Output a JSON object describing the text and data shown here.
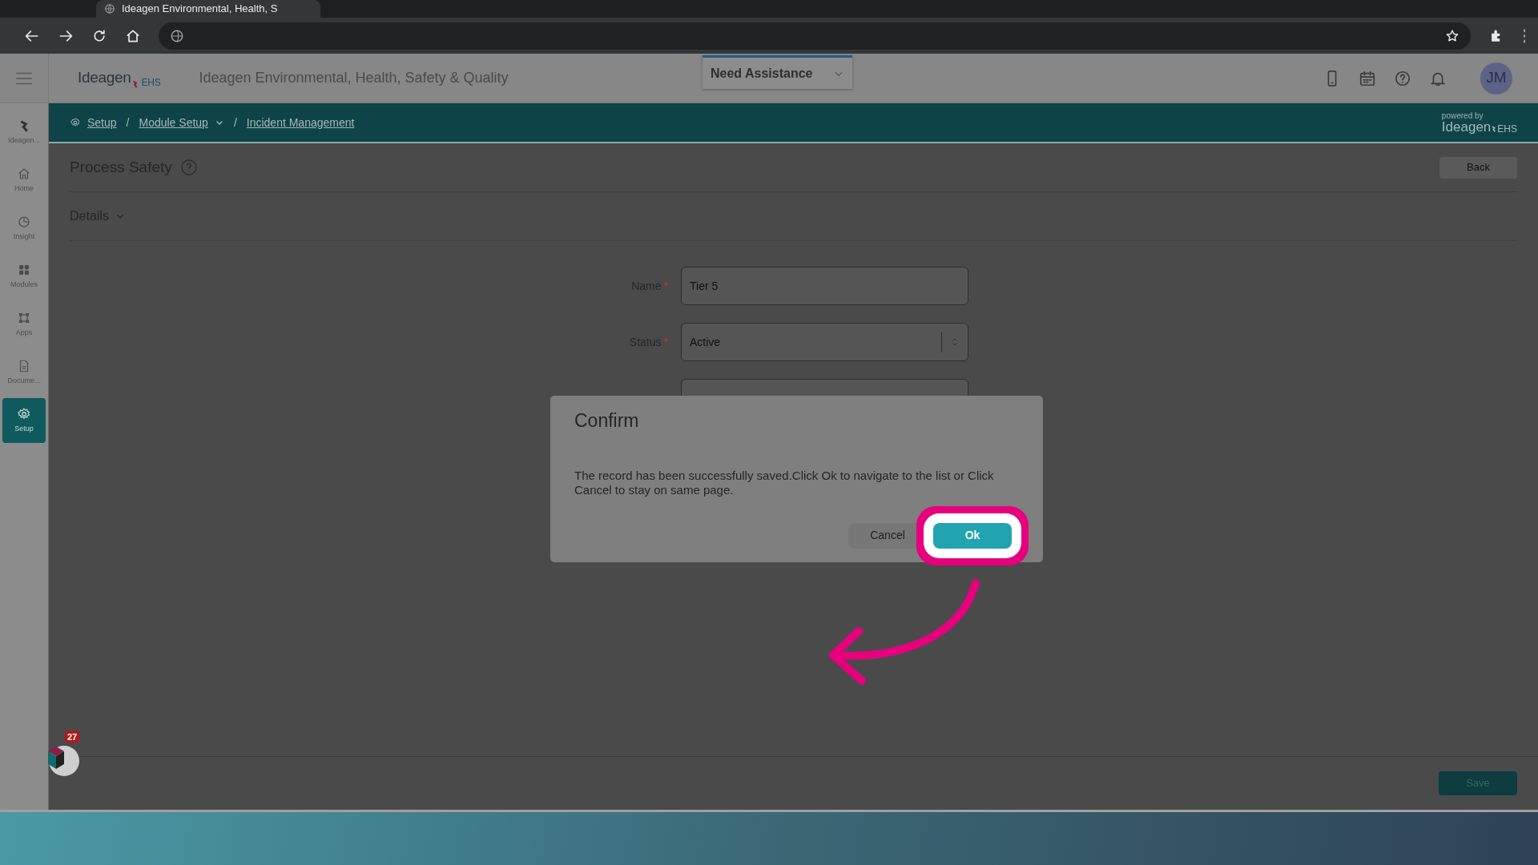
{
  "browser": {
    "tab_title": "Ideagen Environmental, Health, S"
  },
  "header": {
    "logo": "Ideagen",
    "logo_suffix": "EHS",
    "title": "Ideagen Environmental, Health, Safety & Quality",
    "assistance": "Need Assistance",
    "avatar": "JM"
  },
  "sidebar": {
    "items": [
      {
        "label": "Ideagen...",
        "kind": "logo",
        "selected": false
      },
      {
        "label": "Home",
        "kind": "home",
        "selected": false
      },
      {
        "label": "Insight",
        "kind": "insight",
        "selected": false
      },
      {
        "label": "Modules",
        "kind": "modules",
        "selected": false
      },
      {
        "label": "Apps",
        "kind": "apps",
        "selected": false
      },
      {
        "label": "Docume...",
        "kind": "document",
        "selected": false
      },
      {
        "label": "Setup",
        "kind": "setup",
        "selected": true
      }
    ]
  },
  "breadcrumb": [
    {
      "label": "Setup",
      "kind": "home"
    },
    {
      "label": "Module Setup",
      "kind": "dropdown",
      "separator": "/"
    },
    {
      "label": "Incident Management",
      "kind": "plain",
      "separator": "/"
    }
  ],
  "powered_by": {
    "caption": "powered by",
    "logo": "Ideagen",
    "suffix": "EHS"
  },
  "page": {
    "title": "Process Safety",
    "back": "Back",
    "section": "Details",
    "save": "Save",
    "fields": [
      {
        "kind": "text",
        "label": "Name",
        "required_mark": "*",
        "value": "Tier 5"
      },
      {
        "kind": "select",
        "label": "Status",
        "required_mark": "*",
        "value": "Active"
      },
      {
        "kind": "textarea"
      }
    ]
  },
  "chat": {
    "badge": "27"
  },
  "dialog": {
    "title": "Confirm",
    "message": "The record has been successfully saved.Click Ok to navigate to the list or Click Cancel to stay on same page.",
    "buttons": [
      {
        "label": "Cancel",
        "kind": "secondary",
        "highlighted": false
      },
      {
        "label": "Ok",
        "kind": "primary",
        "highlighted": true
      }
    ]
  }
}
